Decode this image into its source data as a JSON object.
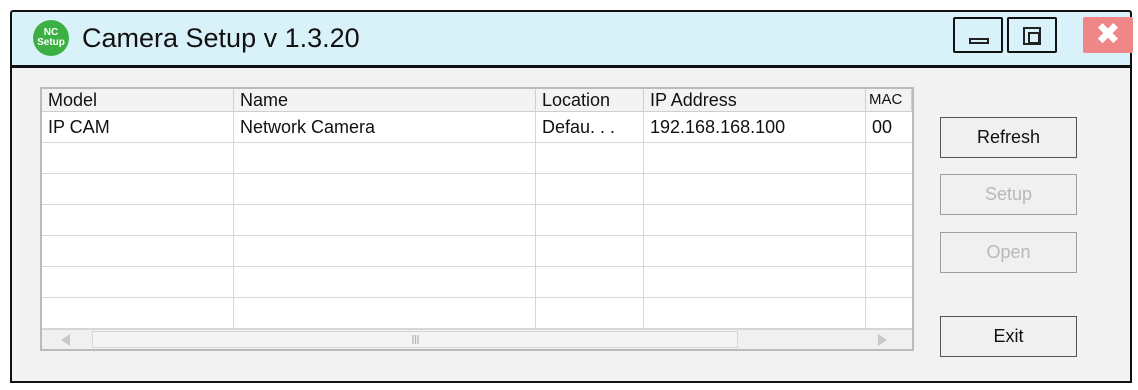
{
  "window": {
    "title": "Camera Setup v 1.3.20",
    "app_icon_text": [
      "NC",
      "Setup"
    ],
    "controls": {
      "minimize": "minimize",
      "maximize": "maximize",
      "close": "✖"
    }
  },
  "table": {
    "columns": [
      "Model",
      "Name",
      "Location",
      "IP Address",
      "MAC"
    ],
    "rows": [
      [
        "IP CAM",
        "Network Camera",
        "Defau. . .",
        "192.168.168.100",
        "00"
      ],
      [
        "",
        "",
        "",
        "",
        ""
      ],
      [
        "",
        "",
        "",
        "",
        ""
      ],
      [
        "",
        "",
        "",
        "",
        ""
      ],
      [
        "",
        "",
        "",
        "",
        ""
      ],
      [
        "",
        "",
        "",
        "",
        ""
      ],
      [
        "",
        "",
        "",
        "",
        ""
      ]
    ],
    "scrollbar_thumb_text": "III"
  },
  "buttons": {
    "refresh": "Refresh",
    "setup": "Setup",
    "open": "Open",
    "exit": "Exit"
  },
  "colors": {
    "titlebar": "#d9f1f9",
    "close_button": "#f08787",
    "app_icon": "#3cb043",
    "client_bg": "#f2f2f2"
  }
}
